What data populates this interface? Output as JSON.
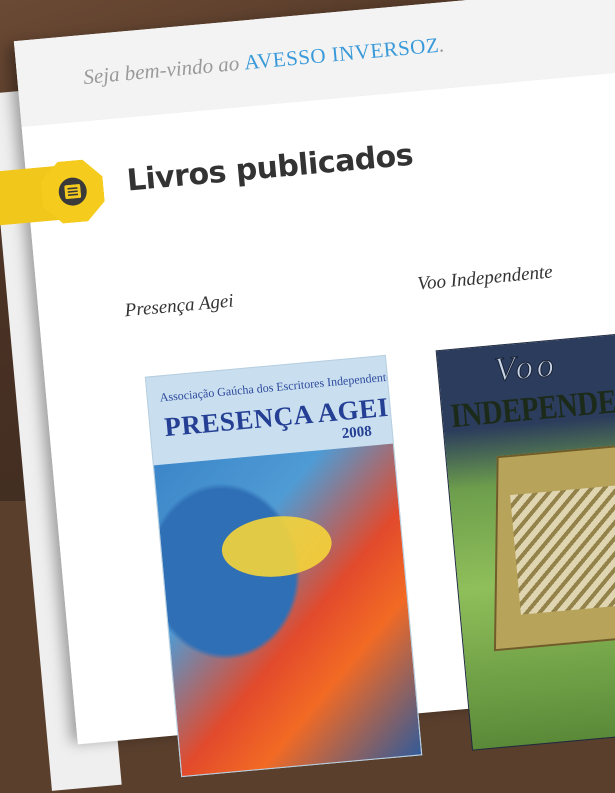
{
  "header": {
    "welcome_prefix": "Seja bem-vindo ao ",
    "site_name": "AVESSO INVERSOZ",
    "welcome_suffix": "."
  },
  "section": {
    "title": "Livros publicados",
    "icon": "list-icon"
  },
  "books": [
    {
      "label": "Presença Agei",
      "cover": {
        "association": "Associação Gaúcha dos Escritores Independentes",
        "title": "PRESENÇA AGEI",
        "year": "2008"
      }
    },
    {
      "label": "Voo Independente",
      "cover": {
        "top_word": "Voo",
        "title": "INDEPENDENTE"
      }
    }
  ],
  "colors": {
    "accent_link": "#3a9ad9",
    "badge": "#f5cc1e",
    "background": "#5a3f2d"
  }
}
